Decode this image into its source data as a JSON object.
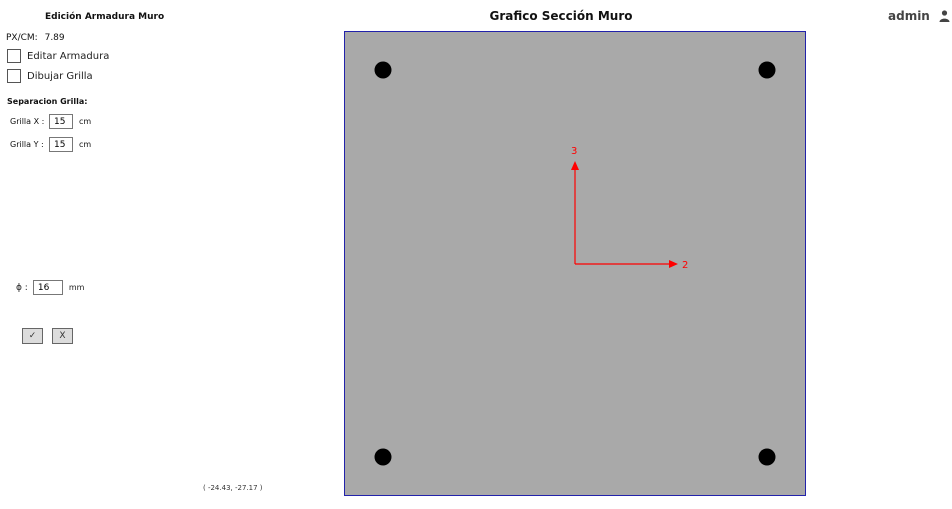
{
  "panel": {
    "title": "Edición Armadura Muro",
    "px_cm_label": "PX/CM:",
    "px_cm_value": "7.89",
    "editar_label": "Editar Armadura",
    "editar_checked": false,
    "dibujar_label": "Dibujar Grilla",
    "dibujar_checked": false,
    "separacion_title": "Separacion Grilla:",
    "grilla_x_label": "Grilla X :",
    "grilla_x_value": "15",
    "grilla_x_unit": "cm",
    "grilla_y_label": "Grilla Y :",
    "grilla_y_value": "15",
    "grilla_y_unit": "cm",
    "phi_label": "ϕ :",
    "phi_value": "16",
    "phi_unit": "mm",
    "ok_label": "✓",
    "cancel_label": "X",
    "coords": "( -24.43,  -27.17 )"
  },
  "header": {
    "canvas_title": "Grafico Sección Muro",
    "user_name": "admin",
    "user_icon": "person-icon"
  },
  "canvas": {
    "fill_color": "#a9a9a9",
    "border_color": "#2222aa",
    "bar_color": "#000000",
    "axis_color": "#ff0000",
    "axis_x_label": "2",
    "axis_y_label": "3",
    "bar_count": 4
  }
}
